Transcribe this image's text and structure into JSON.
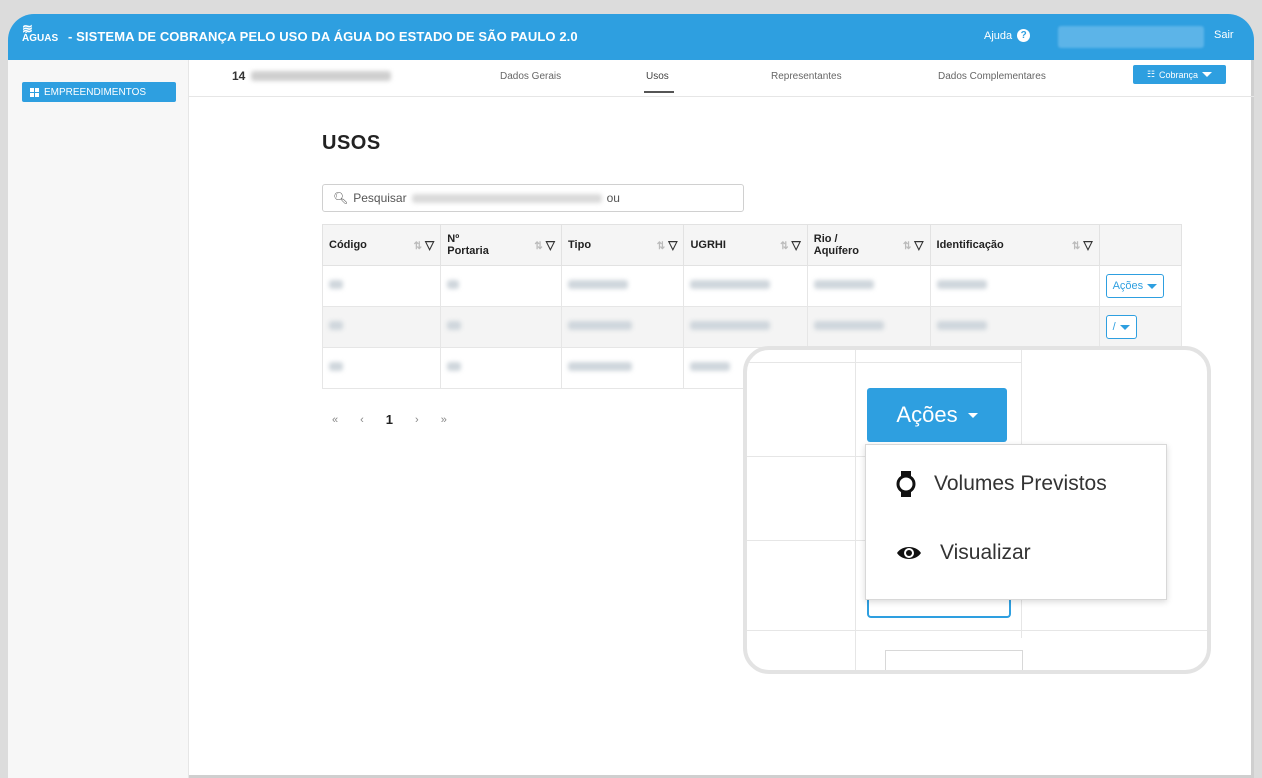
{
  "header": {
    "app_title": "- SISTEMA DE COBRANÇA PELO USO DA ÁGUA DO ESTADO DE SÃO PAULO 2.0",
    "logo_text": "ÁGUAS",
    "help_label": "Ajuda",
    "logout_label": "Sair"
  },
  "sidebar": {
    "items": [
      {
        "label": "EMPREENDIMENTOS",
        "icon": "grid-icon"
      }
    ]
  },
  "tabs": {
    "record_id": "14",
    "items": [
      {
        "label": "Dados Gerais"
      },
      {
        "label": "Usos"
      },
      {
        "label": "Representantes"
      },
      {
        "label": "Dados Complementares"
      }
    ],
    "active": "Usos",
    "cobranca_label": "Cobrança"
  },
  "main": {
    "title": "USOS",
    "search_label": "Pesquisar",
    "search_tail": "ou",
    "columns": [
      "Código",
      "Nº Portaria",
      "Tipo",
      "UGRHI",
      "Rio / Aquífero",
      "Identificação"
    ],
    "row_action_label": "Ações",
    "pagination": {
      "first": "«",
      "prev": "‹",
      "current": "1",
      "next": "›",
      "last": "»"
    }
  },
  "zoom": {
    "button_label": "Ações",
    "menu": [
      {
        "label": "Volumes Previstos",
        "icon": "watch-icon"
      },
      {
        "label": "Visualizar",
        "icon": "eye-icon"
      }
    ]
  },
  "colors": {
    "primary": "#2e9fe0",
    "background": "#ffffff"
  }
}
